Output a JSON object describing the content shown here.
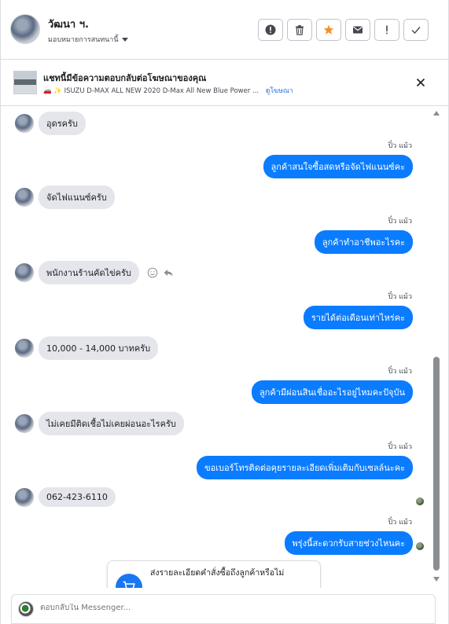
{
  "header": {
    "contact_name": "วัฒนา ฯ.",
    "assign_label": "มอบหมายการสนทนานี้",
    "actions": [
      "report-icon",
      "trash-icon",
      "star-icon",
      "mail-icon",
      "exclamation-icon",
      "check-icon"
    ],
    "accent_star": "#f0932b"
  },
  "notice": {
    "title": "แชทนี้มีข้อความตอบกลับต่อโฆษณาของคุณ",
    "ad_text": "ISUZU D-MAX ALL NEW 2020 D-Max All New Blue Power ...",
    "link": "ดูโฆษณา"
  },
  "messages": [
    {
      "dir": "in",
      "text": "อุดรครับ"
    },
    {
      "dir": "out",
      "sender": "ปิ๋ว แม้ว",
      "text": "ลูกค้าสนใจซื้อสดหรือจัดไฟแนนซ์คะ"
    },
    {
      "dir": "in",
      "text": "จัดไฟแนนซ์ครับ"
    },
    {
      "dir": "out",
      "sender": "ปิ๋ว แม้ว",
      "text": "ลูกค้าทำอาชีพอะไรคะ"
    },
    {
      "dir": "in",
      "text": "พนักงานร้านคัดไข่ครับ"
    },
    {
      "dir": "out",
      "sender": "ปิ๋ว แม้ว",
      "text": "รายได้ต่อเดือนเท่าไหร่คะ"
    },
    {
      "dir": "in",
      "text": "10,000 - 14,000 บาทครับ"
    },
    {
      "dir": "out",
      "sender": "ปิ๋ว แม้ว",
      "text": "ลูกค้ามีผ่อนสินเชื่ออะไรอยู่ไหมคะปัจุบัน"
    },
    {
      "dir": "in",
      "text": "ไม่เคยมีติดเชื้อไม่เคยผ่อนอะไรครับ"
    },
    {
      "dir": "out",
      "sender": "ปิ๋ว แม้ว",
      "text": "ขอเบอร์โทรติดต่อคุยรายละเอียดเพิ่มเติมกับเซลล์นะคะ"
    },
    {
      "dir": "in",
      "text": "062-423-6110"
    },
    {
      "dir": "out",
      "sender": "ปิ๋ว แม้ว",
      "text": "พรุ่งนี้สะดวกรับสายช่วงไหนคะ"
    }
  ],
  "card": {
    "text_line1": "ส่งรายละเอียดคำสั่งซื้อถึงลูกค้าหรือไม่"
  },
  "composer": {
    "placeholder": "ตอบกลับใน Messenger..."
  },
  "colors": {
    "outgoing_bubble": "#0a7cff",
    "incoming_bubble": "#e4e6eb"
  }
}
